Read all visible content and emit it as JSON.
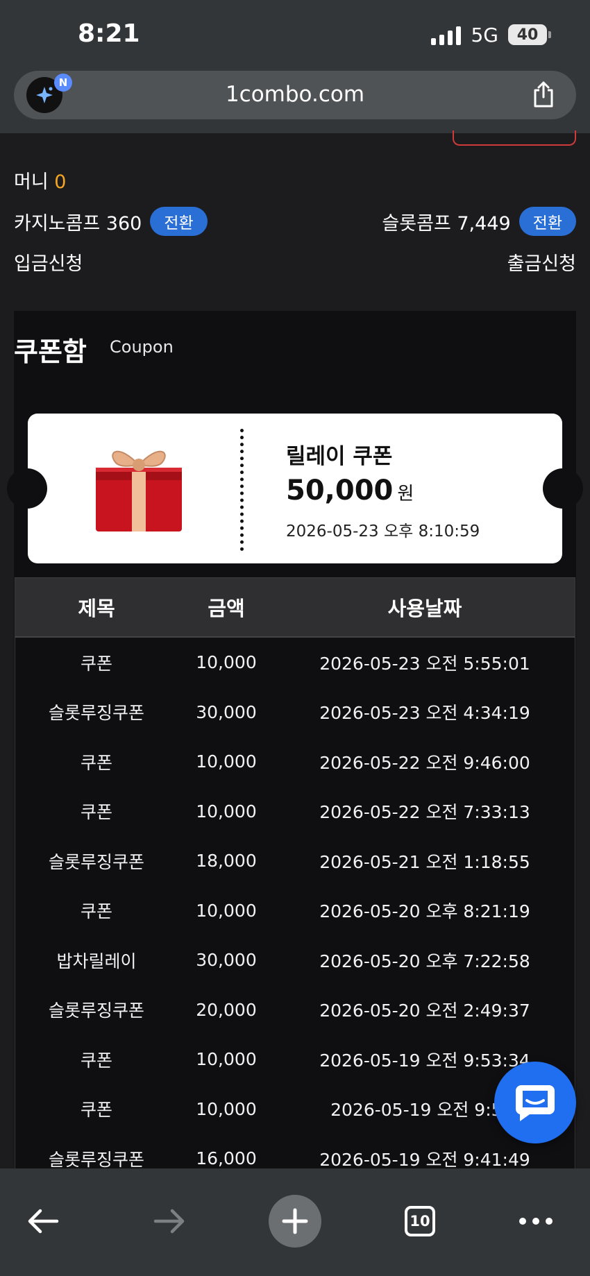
{
  "status": {
    "time": "8:21",
    "network": "5G",
    "battery": "40"
  },
  "browser": {
    "url": "1combo.com",
    "avatar_badge": "N",
    "tab_count": "10"
  },
  "account": {
    "money_label": "머니",
    "money_value": "0",
    "casino_comp_label": "카지노콤프 360",
    "slot_comp_label": "슬롯콤프 7,449",
    "convert_label": "전환",
    "deposit_label": "입금신청",
    "withdraw_label": "출금신청"
  },
  "coupon": {
    "title": "쿠폰함",
    "subtitle": "Coupon",
    "featured": {
      "name": "릴레이 쿠폰",
      "amount": "50,000",
      "unit": "원",
      "date": "2026-05-23 오후 8:10:59"
    },
    "columns": [
      "제목",
      "금액",
      "사용날짜"
    ],
    "rows": [
      {
        "title": "쿠폰",
        "amount": "10,000",
        "date": "2026-05-23 오전 5:55:01"
      },
      {
        "title": "슬롯루징쿠폰",
        "amount": "30,000",
        "date": "2026-05-23 오전 4:34:19"
      },
      {
        "title": "쿠폰",
        "amount": "10,000",
        "date": "2026-05-22 오전 9:46:00"
      },
      {
        "title": "쿠폰",
        "amount": "10,000",
        "date": "2026-05-22 오전 7:33:13"
      },
      {
        "title": "슬롯루징쿠폰",
        "amount": "18,000",
        "date": "2026-05-21 오전 1:18:55"
      },
      {
        "title": "쿠폰",
        "amount": "10,000",
        "date": "2026-05-20 오후 8:21:19"
      },
      {
        "title": "밥차릴레이",
        "amount": "30,000",
        "date": "2026-05-20 오후 7:22:58"
      },
      {
        "title": "슬롯루징쿠폰",
        "amount": "20,000",
        "date": "2026-05-20 오전 2:49:37"
      },
      {
        "title": "쿠폰",
        "amount": "10,000",
        "date": "2026-05-19 오전 9:53:34"
      },
      {
        "title": "쿠폰",
        "amount": "10,000",
        "date": "2026-05-19 오전 9:53:"
      },
      {
        "title": "슬롯루징쿠폰",
        "amount": "16,000",
        "date": "2026-05-19 오전 9:41:49"
      }
    ]
  }
}
